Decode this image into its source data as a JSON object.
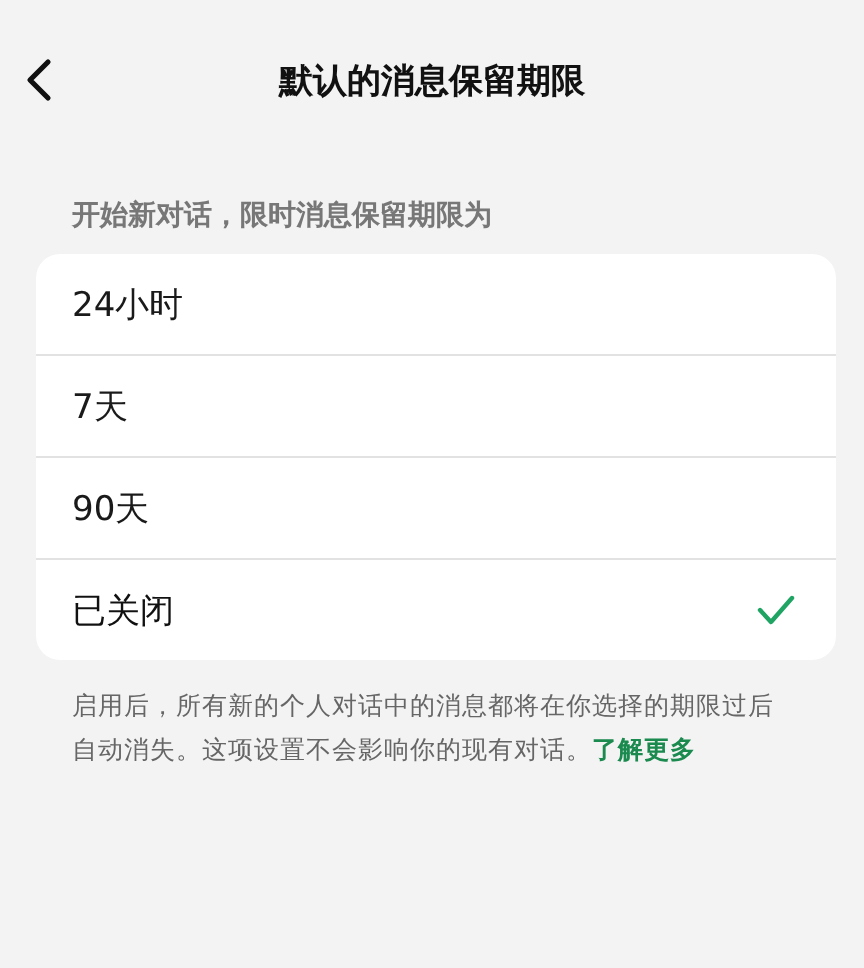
{
  "header": {
    "title": "默认的消息保留期限"
  },
  "section": {
    "heading": "开始新对话，限时消息保留期限为"
  },
  "options": [
    {
      "label": "24小时",
      "selected": false
    },
    {
      "label": "7天",
      "selected": false
    },
    {
      "label": "90天",
      "selected": false
    },
    {
      "label": "已关闭",
      "selected": true
    }
  ],
  "footer": {
    "text": "启用后，所有新的个人对话中的消息都将在你选择的期限过后自动消失。这项设置不会影响你的现有对话。",
    "link": "了解更多"
  }
}
